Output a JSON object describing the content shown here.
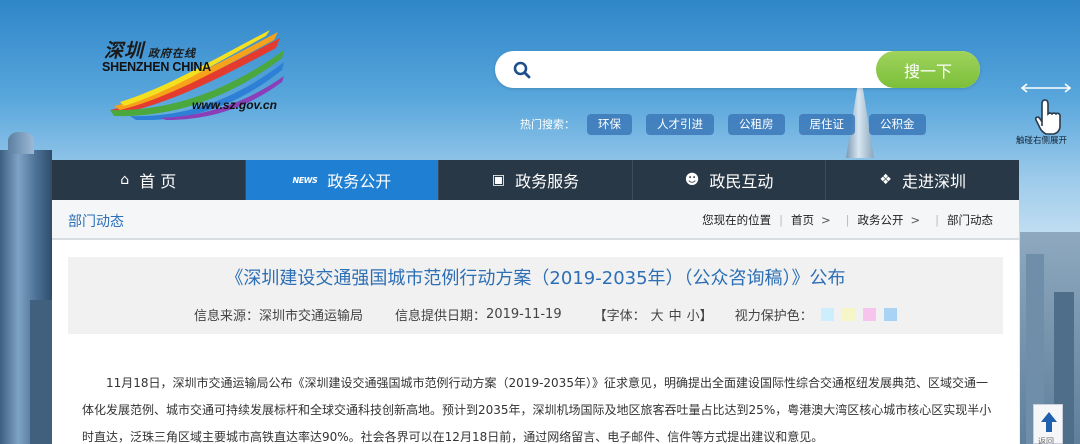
{
  "logo": {
    "cn_main": "深圳",
    "cn_sub": "政府在线",
    "en": "SHENZHEN CHINA",
    "url": "www.sz.gov.cn"
  },
  "search": {
    "value": "",
    "placeholder": "",
    "button_label": "搜一下"
  },
  "hot_search": {
    "label": "热门搜索：",
    "tags": [
      "环保",
      "人才引进",
      "公租房",
      "居住证",
      "公积金"
    ]
  },
  "gesture": {
    "label": "触碰右侧展开"
  },
  "nav": {
    "items": [
      {
        "label": "首 页",
        "icon": "home-icon"
      },
      {
        "label": "政务公开",
        "icon": "news-icon",
        "icon_text": "NEWS"
      },
      {
        "label": "政务服务",
        "icon": "monitor-icon"
      },
      {
        "label": "政民互动",
        "icon": "people-icon"
      },
      {
        "label": "走进深圳",
        "icon": "compass-icon"
      }
    ],
    "active_index": 1,
    "active_color": "#1f7fd3"
  },
  "section": {
    "title": "部门动态"
  },
  "breadcrumb": {
    "prefix": "您现在的位置",
    "items": [
      "首页",
      "政务公开",
      "部门动态"
    ],
    "separator": ">"
  },
  "article": {
    "title": "《深圳建设交通强国城市范例行动方案（2019-2035年）（公众咨询稿）》公布",
    "source_label": "信息来源：",
    "source": "深圳市交通运输局",
    "date_label": "信息提供日期：",
    "date": "2019-11-19",
    "font_label": "【字体：",
    "font_sizes": [
      "大",
      "中",
      "小"
    ],
    "font_close": "】",
    "eye_label": "视力保护色：",
    "eye_colors": [
      "#cdeefc",
      "#f6f5c8",
      "#f7c4ee",
      "#a9d3f5"
    ],
    "body": "11月18日，深圳市交通运输局公布《深圳建设交通强国城市范例行动方案（2019-2035年）》征求意见，明确提出全面建设国际性综合交通枢纽发展典范、区域交通一体化发展范例、城市交通可持续发展标杆和全球交通科技创新高地。预计到2035年，深圳机场国际及地区旅客吞吐量占比达到25%，粤港澳大湾区核心城市核心区实现半小时直达，泛珠三角区域主要城市高铁直达率达90%。社会各界可以在12月18日前，通过网络留言、电子邮件、信件等方式提出建议和意见。"
  },
  "back_top": {
    "label": "返回"
  }
}
